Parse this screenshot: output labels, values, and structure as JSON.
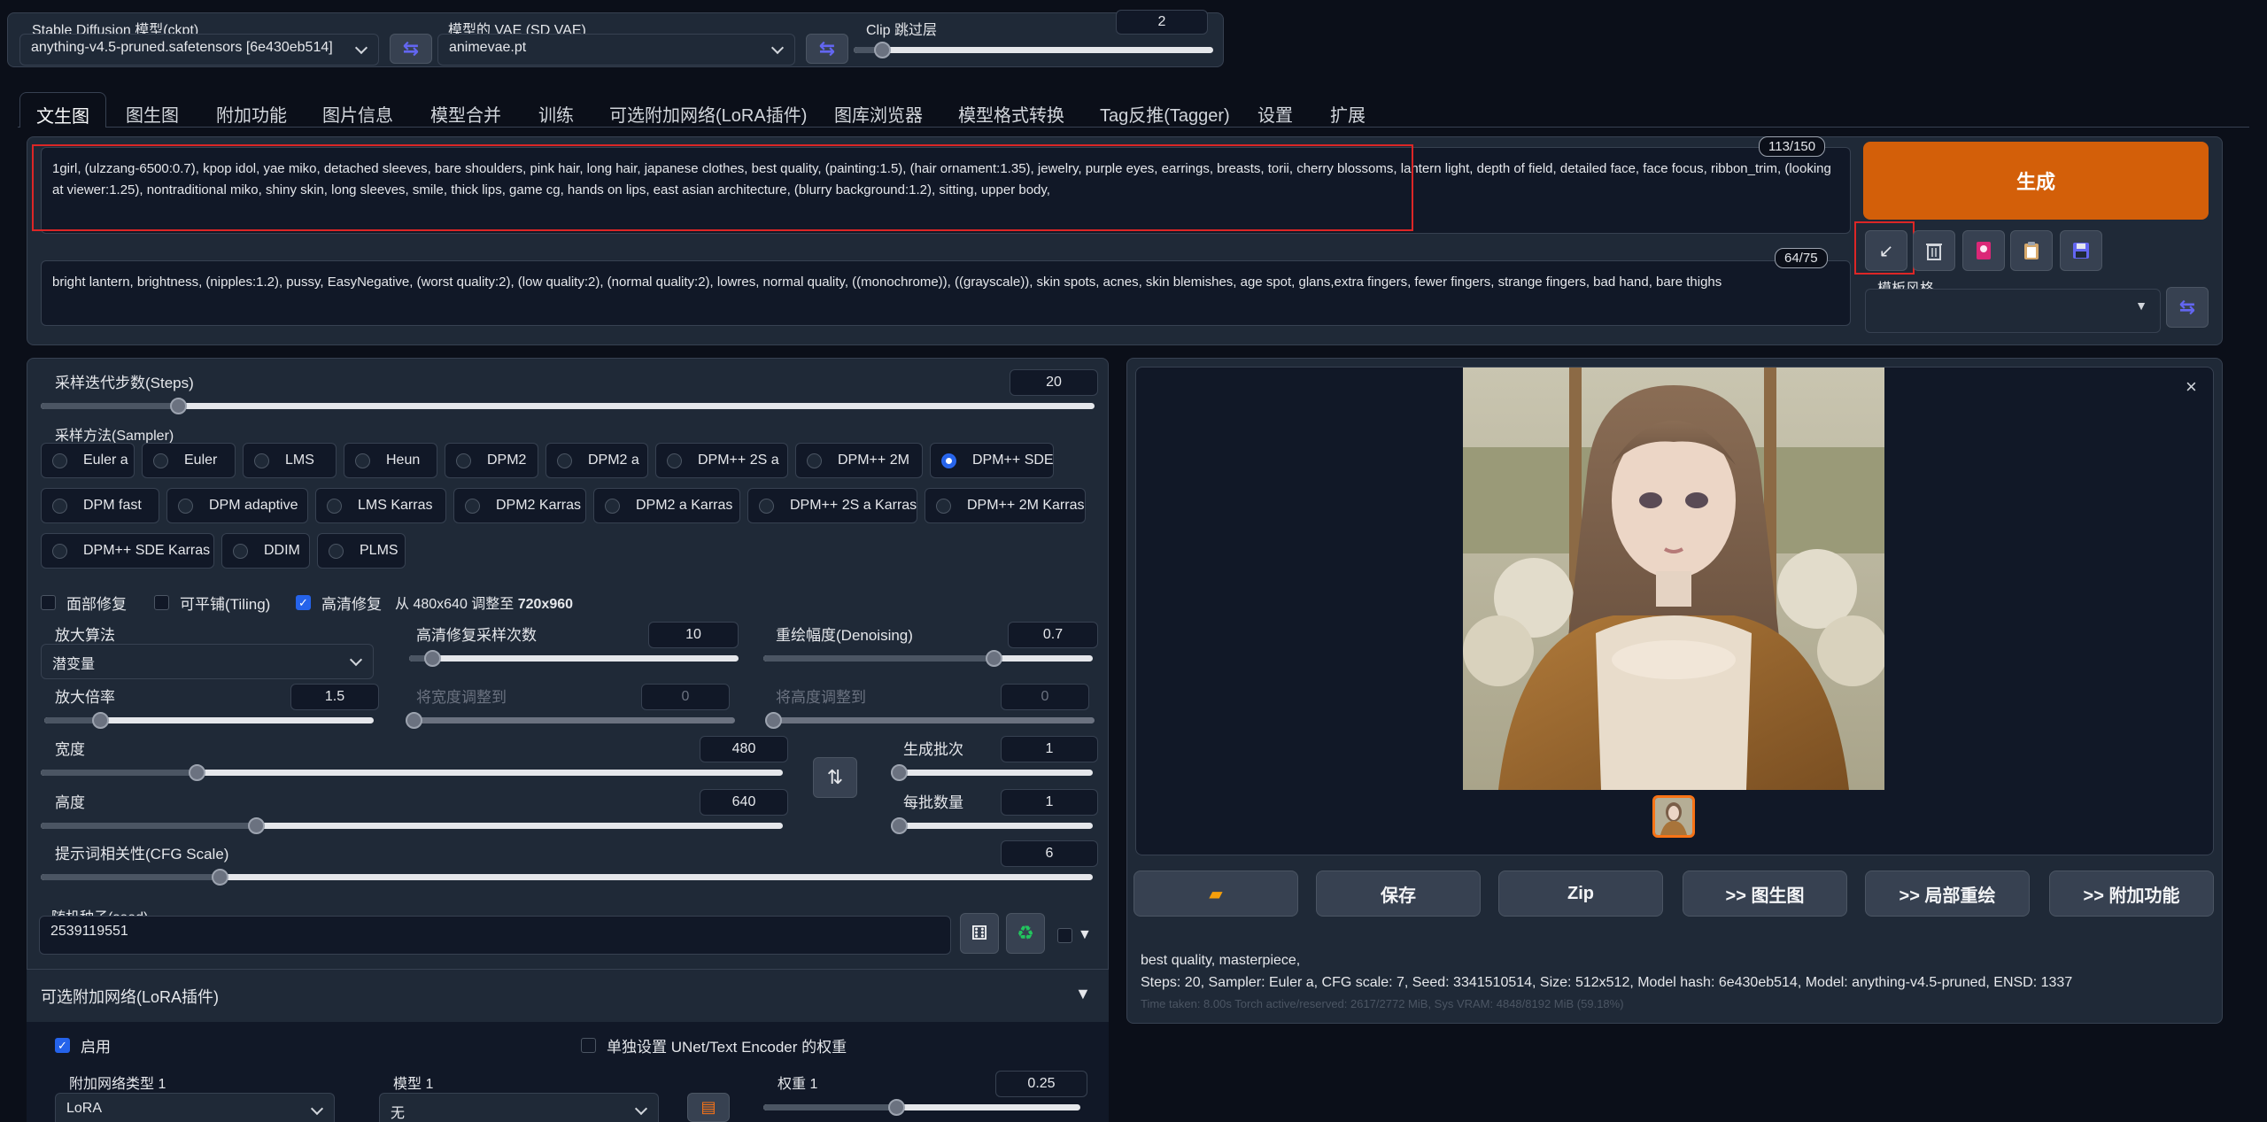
{
  "header": {
    "ckpt_label": "Stable Diffusion 模型(ckpt)",
    "ckpt_value": "anything-v4.5-pruned.safetensors [6e430eb514]",
    "vae_label": "模型的 VAE (SD VAE)",
    "vae_value": "animevae.pt",
    "clip_label": "Clip 跳过层",
    "clip_value": "2",
    "clip_level": 0.08
  },
  "tabs": [
    "文生图",
    "图生图",
    "附加功能",
    "图片信息",
    "模型合并",
    "训练",
    "可选附加网络(LoRA插件)",
    "图库浏览器",
    "模型格式转换",
    "Tag反推(Tagger)",
    "设置",
    "扩展"
  ],
  "prompt": {
    "positive": "1girl, (ulzzang-6500:0.7), kpop idol, yae miko, detached sleeves, bare shoulders, pink hair, long hair, japanese clothes, best quality, (painting:1.5), (hair ornament:1.35), jewelry, purple eyes, earrings, breasts, torii,  cherry blossoms,  lantern light, depth of field, detailed face, face focus, ribbon_trim, (looking at viewer:1.25), nontraditional miko, shiny skin, long sleeves, smile, thick lips, game cg, hands on lips, east asian architecture, (blurry background:1.2), sitting, upper body,",
    "positive_count": "113/150",
    "negative": "bright lantern, brightness, (nipples:1.2), pussy, EasyNegative, (worst quality:2), (low quality:2), (normal quality:2), lowres, normal quality, ((monochrome)), ((grayscale)), skin spots, acnes, skin blemishes, age spot, glans,extra fingers, fewer fingers, strange fingers, bad hand, bare thighs",
    "negative_count": "64/75"
  },
  "generate": {
    "label": "生成",
    "style_label": "模板风格",
    "tool_icons": [
      "arrow-down-left-icon",
      "trash-icon",
      "image-card-icon",
      "clipboard-icon",
      "save-icon"
    ]
  },
  "settings": {
    "steps_label": "采样迭代步数(Steps)",
    "steps_value": "20",
    "steps_level": 0.13,
    "sampler_label": "采样方法(Sampler)",
    "samplers_row1": [
      "Euler a",
      "Euler",
      "LMS",
      "Heun",
      "DPM2",
      "DPM2 a",
      "DPM++ 2S a",
      "DPM++ 2M",
      "DPM++ SDE"
    ],
    "samplers_row2": [
      "DPM fast",
      "DPM adaptive",
      "LMS Karras",
      "DPM2 Karras",
      "DPM2 a Karras",
      "DPM++ 2S a Karras",
      "DPM++ 2M Karras"
    ],
    "samplers_row3": [
      "DPM++ SDE Karras",
      "DDIM",
      "PLMS"
    ],
    "sampler_selected": "DPM++ SDE",
    "face_restore_label": "面部修复",
    "tiling_label": "可平铺(Tiling)",
    "hires_label": "高清修复",
    "hires_info_prefix": "从 480x640 调整至 ",
    "hires_info_bold": "720x960",
    "upscaler_label": "放大算法",
    "upscaler_value": "潜变量",
    "hires_steps_label": "高清修复采样次数",
    "hires_steps_value": "10",
    "hires_steps_level": 0.07,
    "denoise_label": "重绘幅度(Denoising)",
    "denoise_value": "0.7",
    "denoise_level": 0.7,
    "upscale_by_label": "放大倍率",
    "upscale_by_value": "1.5",
    "upscale_by_level": 0.17,
    "resize_w_label": "将宽度调整到",
    "resize_w_value": "0",
    "resize_h_label": "将高度调整到",
    "resize_h_value": "0",
    "width_label": "宽度",
    "width_value": "480",
    "width_level": 0.21,
    "height_label": "高度",
    "height_value": "640",
    "height_level": 0.29,
    "batch_count_label": "生成批次",
    "batch_count_value": "1",
    "batch_size_label": "每批数量",
    "batch_size_value": "1",
    "cfg_label": "提示词相关性(CFG Scale)",
    "cfg_value": "6",
    "cfg_level": 0.17,
    "seed_label": "随机种子(seed)",
    "seed_value": "2539119551"
  },
  "lora": {
    "title": "可选附加网络(LoRA插件)",
    "enable_label": "启用",
    "separate_label": "单独设置 UNet/Text Encoder 的权重",
    "type_label": "附加网络类型 1",
    "type_value": "LoRA",
    "model_label": "模型 1",
    "model_value": "无",
    "weight_label": "权重 1",
    "weight_value": "0.25",
    "weight_level": 0.42
  },
  "output": {
    "buttons": [
      "保存",
      "Zip",
      ">> 图生图",
      ">> 局部重绘",
      ">> 附加功能"
    ],
    "info_line1": "best quality, masterpiece,",
    "info_line2": "Steps: 20, Sampler: Euler a, CFG scale: 7, Seed: 3341510514, Size: 512x512, Model hash: 6e430eb514, Model: anything-v4.5-pruned, ENSD: 1337",
    "info_line3": "Time taken: 8.00s  Torch active/reserved: 2617/2772 MiB, Sys VRAM: 4848/8192 MiB (59.18%)"
  },
  "colors": {
    "generate_button": "#d35f09",
    "accent": "#2563eb",
    "highlight_box": "#dc2626"
  }
}
